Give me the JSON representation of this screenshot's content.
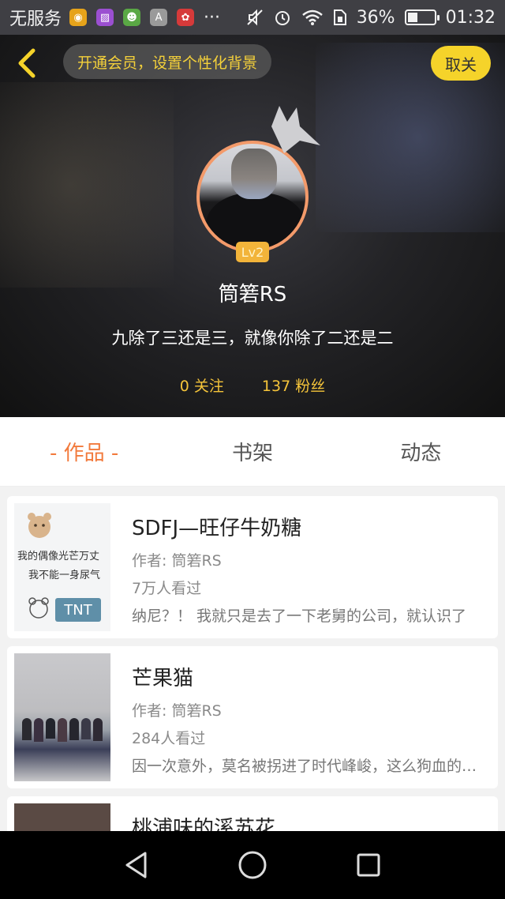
{
  "status_bar": {
    "carrier": "无服务",
    "more": "···",
    "battery_text": "36%",
    "battery_level": 0.36,
    "time": "01:32",
    "app_icons": [
      {
        "name": "weibo-icon",
        "color": "#e6a31a",
        "glyph": "◉"
      },
      {
        "name": "gallery-app-icon",
        "color": "#9b4fd1",
        "glyph": "▨"
      },
      {
        "name": "chat-app-icon",
        "color": "#5aa845",
        "glyph": "☻"
      },
      {
        "name": "font-app-icon",
        "color": "#9a9a9a",
        "glyph": "A"
      },
      {
        "name": "huawei-icon",
        "color": "#d63a3a",
        "glyph": "✿"
      }
    ]
  },
  "header": {
    "vip_prompt": "开通会员，设置个性化背景",
    "unfollow_label": "取关",
    "level": "Lv2",
    "username": "筒箬RS",
    "signature": "九除了三还是三，就像你除了二还是二",
    "following": "0 关注",
    "followers": "137 粉丝"
  },
  "tabs": [
    {
      "label": "- 作品 -",
      "active": true
    },
    {
      "label": "书架",
      "active": false
    },
    {
      "label": "动态",
      "active": false
    }
  ],
  "books": [
    {
      "title": "SDFJ—旺仔牛奶糖",
      "author": "作者: 筒箬RS",
      "views": "7万人看过",
      "desc": "纳尼？！ 我就只是去了一下老舅的公司，就认识了",
      "cover_text": [
        "我的偶像光芒万丈",
        "我不能一身尿气",
        "TNT"
      ]
    },
    {
      "title": "芒果猫",
      "author": "作者: 筒箬RS",
      "views": "284人看过",
      "desc": "因一次意外，莫名被拐进了时代峰峻，这么狗血的剧情",
      "cover_text": []
    },
    {
      "title": "桃浦味的溪苏花",
      "author": "",
      "views": "",
      "desc": "",
      "cover_text": []
    }
  ]
}
